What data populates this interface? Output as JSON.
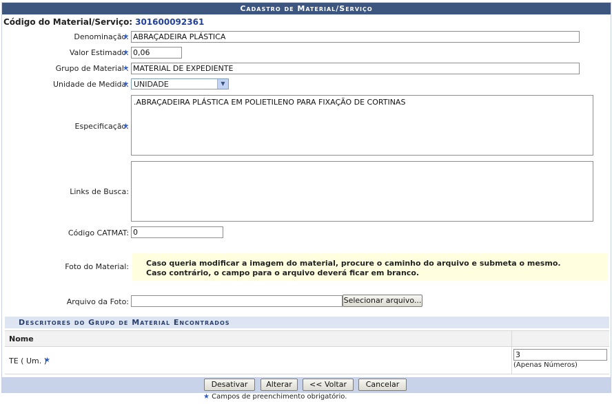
{
  "caption": "Cadastro de Material/Serviço",
  "code": {
    "label": "Código do Material/Serviço:",
    "value": "301600092361"
  },
  "fields": {
    "denominacao": {
      "label": "Denominação:",
      "value": "ABRAÇADEIRA PLÁSTICA"
    },
    "valor": {
      "label": "Valor Estimado:",
      "value": "0,06"
    },
    "grupo": {
      "label": "Grupo de Material :",
      "value": "MATERIAL DE EXPEDIENTE"
    },
    "unidade": {
      "label": "Unidade de Medida:",
      "value": "UNIDADE"
    },
    "especificacao": {
      "label": "Especificação:",
      "value": ".ABRAÇADEIRA PLÁSTICA EM POLIETILENO PARA FIXAÇÃO DE CORTINAS"
    },
    "links": {
      "label": "Links de Busca:",
      "value": ""
    },
    "catmat": {
      "label": "Código CATMAT:",
      "value": "0"
    },
    "foto": {
      "label": "Foto do Material:",
      "note_line1": "Caso queria modificar a imagem do material, procure o caminho do arquivo e submeta o mesmo.",
      "note_line2": "Caso contrário, o campo para o arquivo deverá ficar em branco."
    },
    "arquivo": {
      "label": "Arquivo da Foto:",
      "value": "",
      "button": "Selecionar arquivo..."
    }
  },
  "descritores": {
    "title": "Descritores do Grupo de Material Encontrados",
    "column": "Nome",
    "rows": [
      {
        "name": "TE ( Um. )",
        "value": "3",
        "hint": "(Apenas Números)"
      }
    ]
  },
  "buttons": {
    "desativar": "Desativar",
    "alterar": "Alterar",
    "voltar": "<< Voltar",
    "cancelar": "Cancelar"
  },
  "required_note": "Campos de preenchimento obrigatório.",
  "star": "★"
}
